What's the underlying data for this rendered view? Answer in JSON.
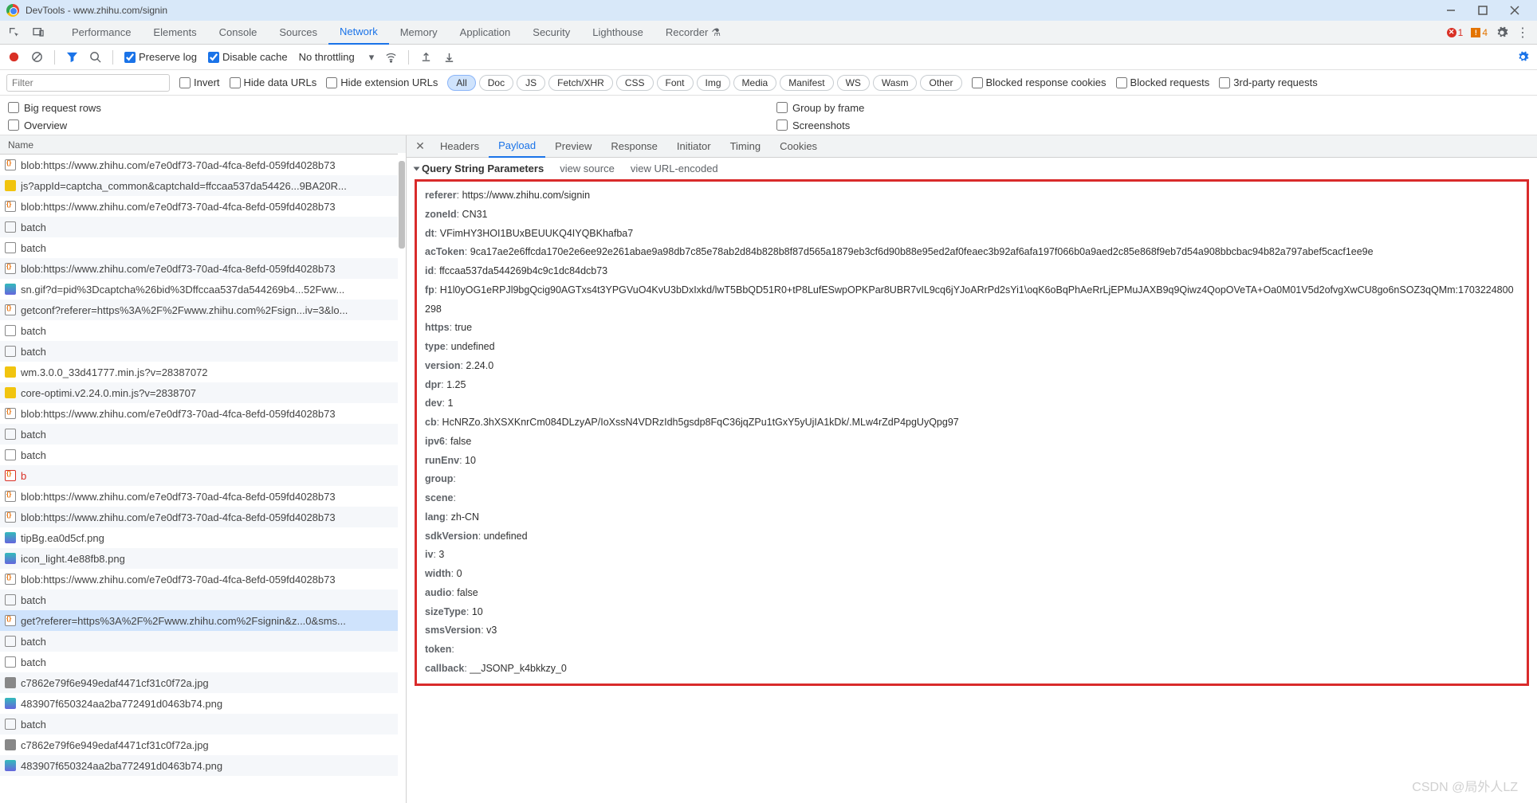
{
  "window": {
    "title": "DevTools - www.zhihu.com/signin"
  },
  "mainTabs": {
    "items": [
      "Performance",
      "Elements",
      "Console",
      "Sources",
      "Network",
      "Memory",
      "Application",
      "Security",
      "Lighthouse",
      "Recorder"
    ],
    "recorderIcon": "⚗",
    "active": "Network",
    "errors": "1",
    "warnings": "4"
  },
  "toolbar": {
    "preserveLog": "Preserve log",
    "disableCache": "Disable cache",
    "throttling": "No throttling"
  },
  "filterRow": {
    "filterPlaceholder": "Filter",
    "invert": "Invert",
    "hideData": "Hide data URLs",
    "hideExt": "Hide extension URLs",
    "types": [
      "All",
      "Doc",
      "JS",
      "Fetch/XHR",
      "CSS",
      "Font",
      "Img",
      "Media",
      "Manifest",
      "WS",
      "Wasm",
      "Other"
    ],
    "blockedCookies": "Blocked response cookies",
    "blockedRequests": "Blocked requests",
    "thirdParty": "3rd-party requests"
  },
  "options": {
    "bigRows": "Big request rows",
    "overview": "Overview",
    "groupFrame": "Group by frame",
    "screenshots": "Screenshots"
  },
  "listHeader": "Name",
  "requests": [
    {
      "icon": "xhr",
      "text": "blob:https://www.zhihu.com/e7e0df73-70ad-4fca-8efd-059fd4028b73"
    },
    {
      "icon": "js",
      "text": "js?appId=captcha_common&captchaId=ffccaa537da54426...9BA20R..."
    },
    {
      "icon": "xhr",
      "text": "blob:https://www.zhihu.com/e7e0df73-70ad-4fca-8efd-059fd4028b73"
    },
    {
      "icon": "doc",
      "text": "batch"
    },
    {
      "icon": "doc",
      "text": "batch"
    },
    {
      "icon": "xhr",
      "text": "blob:https://www.zhihu.com/e7e0df73-70ad-4fca-8efd-059fd4028b73"
    },
    {
      "icon": "img",
      "text": "sn.gif?d=pid%3Dcaptcha%26bid%3Dffccaa537da544269b4...52Fww..."
    },
    {
      "icon": "xhr",
      "text": "getconf?referer=https%3A%2F%2Fwww.zhihu.com%2Fsign...iv=3&lo..."
    },
    {
      "icon": "doc",
      "text": "batch"
    },
    {
      "icon": "doc",
      "text": "batch"
    },
    {
      "icon": "js",
      "text": "wm.3.0.0_33d41777.min.js?v=28387072"
    },
    {
      "icon": "js",
      "text": "core-optimi.v2.24.0.min.js?v=2838707"
    },
    {
      "icon": "xhr",
      "text": "blob:https://www.zhihu.com/e7e0df73-70ad-4fca-8efd-059fd4028b73"
    },
    {
      "icon": "doc",
      "text": "batch"
    },
    {
      "icon": "doc",
      "text": "batch"
    },
    {
      "icon": "xhr",
      "text": "b",
      "special": "red"
    },
    {
      "icon": "xhr",
      "text": "blob:https://www.zhihu.com/e7e0df73-70ad-4fca-8efd-059fd4028b73"
    },
    {
      "icon": "xhr",
      "text": "blob:https://www.zhihu.com/e7e0df73-70ad-4fca-8efd-059fd4028b73"
    },
    {
      "icon": "img",
      "text": "tipBg.ea0d5cf.png"
    },
    {
      "icon": "img",
      "text": "icon_light.4e88fb8.png"
    },
    {
      "icon": "xhr",
      "text": "blob:https://www.zhihu.com/e7e0df73-70ad-4fca-8efd-059fd4028b73"
    },
    {
      "icon": "doc",
      "text": "batch"
    },
    {
      "icon": "xhr",
      "text": "get?referer=https%3A%2F%2Fwww.zhihu.com%2Fsignin&z...0&sms...",
      "selected": true
    },
    {
      "icon": "doc",
      "text": "batch"
    },
    {
      "icon": "doc",
      "text": "batch"
    },
    {
      "icon": "png",
      "text": "c7862e79f6e949edaf4471cf31c0f72a.jpg"
    },
    {
      "icon": "img",
      "text": "483907f650324aa2ba772491d0463b74.png"
    },
    {
      "icon": "doc",
      "text": "batch"
    },
    {
      "icon": "png",
      "text": "c7862e79f6e949edaf4471cf31c0f72a.jpg"
    },
    {
      "icon": "img",
      "text": "483907f650324aa2ba772491d0463b74.png"
    }
  ],
  "detail": {
    "tabs": [
      "Headers",
      "Payload",
      "Preview",
      "Response",
      "Initiator",
      "Timing",
      "Cookies"
    ],
    "active": "Payload",
    "sectionTitle": "Query String Parameters",
    "viewSource": "view source",
    "viewURL": "view URL-encoded",
    "params": [
      {
        "k": "referer",
        "v": "https://www.zhihu.com/signin"
      },
      {
        "k": "zoneId",
        "v": "CN31"
      },
      {
        "k": "dt",
        "v": "VFimHY3HOI1BUxBEUUKQ4IYQBKhafba7"
      },
      {
        "k": "acToken",
        "v": "9ca17ae2e6ffcda170e2e6ee92e261abae9a98db7c85e78ab2d84b828b8f87d565a1879eb3cf6d90b88e95ed2af0feaec3b92af6afa197f066b0a9aed2c85e868f9eb7d54a908bbcbac94b82a797abef5cacf1ee9e"
      },
      {
        "k": "id",
        "v": "ffccaa537da544269b4c9c1dc84dcb73"
      },
      {
        "k": "fp",
        "v": "H1l0yOG1eRPJl9bgQcig90AGTxs4t3YPGVuO4KvU3bDxIxkd/lwT5BbQD51R0+tP8LufESwpOPKPar8UBR7vIL9cq6jYJoARrPd2sYi1\\oqK6oBqPhAeRrLjEPMuJAXB9q9Qiwz4QopOVeTA+Oa0M01V5d2ofvgXwCU8go6nSOZ3qQMm:1703224800298"
      },
      {
        "k": "https",
        "v": "true"
      },
      {
        "k": "type",
        "v": "undefined"
      },
      {
        "k": "version",
        "v": "2.24.0"
      },
      {
        "k": "dpr",
        "v": "1.25"
      },
      {
        "k": "dev",
        "v": "1"
      },
      {
        "k": "cb",
        "v": "HcNRZo.3hXSXKnrCm084DLzyAP/IoXssN4VDRzIdh5gsdp8FqC36jqZPu1tGxY5yUjIA1kDk/.MLw4rZdP4pgUyQpg97"
      },
      {
        "k": "ipv6",
        "v": "false"
      },
      {
        "k": "runEnv",
        "v": "10"
      },
      {
        "k": "group",
        "v": ""
      },
      {
        "k": "scene",
        "v": ""
      },
      {
        "k": "lang",
        "v": "zh-CN"
      },
      {
        "k": "sdkVersion",
        "v": "undefined"
      },
      {
        "k": "iv",
        "v": "3"
      },
      {
        "k": "width",
        "v": "0"
      },
      {
        "k": "audio",
        "v": "false"
      },
      {
        "k": "sizeType",
        "v": "10"
      },
      {
        "k": "smsVersion",
        "v": "v3"
      },
      {
        "k": "token",
        "v": ""
      },
      {
        "k": "callback",
        "v": "__JSONP_k4bkkzy_0"
      }
    ]
  },
  "watermark": "CSDN @局外人LZ"
}
